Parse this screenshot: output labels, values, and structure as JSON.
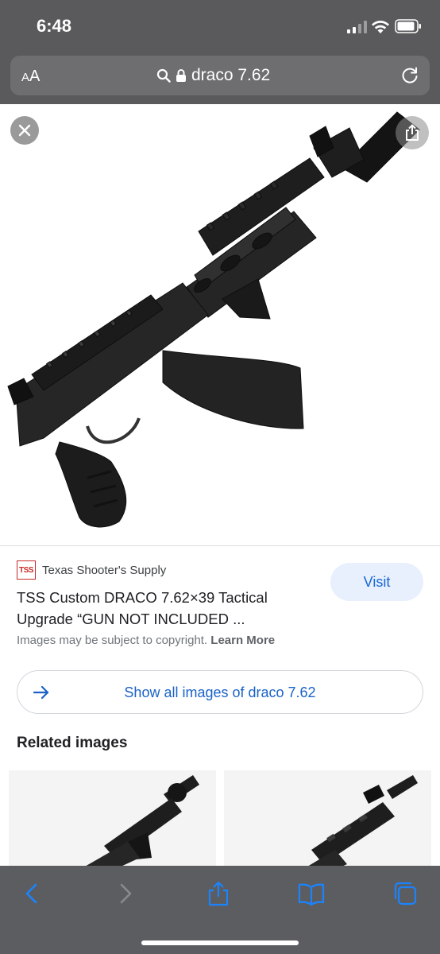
{
  "status_bar": {
    "time": "6:48"
  },
  "address_bar": {
    "text_size_label_small": "A",
    "text_size_label_large": "A",
    "url": "draco 7.62"
  },
  "result": {
    "source_badge": "TSS",
    "source_name": "Texas Shooter's Supply",
    "title": "TSS Custom DRACO 7.62×39 Tactical Upgrade “GUN NOT INCLUDED ...",
    "visit_label": "Visit",
    "copyright_text": "Images may be subject to copyright.",
    "learn_more_label": "Learn More",
    "show_all_label": "Show all images of draco 7.62"
  },
  "related": {
    "heading": "Related images"
  },
  "icons": {
    "close": "close-icon",
    "share": "share-icon",
    "search": "search-icon",
    "lock": "lock-icon",
    "reload": "reload-icon",
    "back": "back-icon",
    "forward": "forward-icon",
    "bookmarks": "bookmarks-icon",
    "tabs": "tabs-icon"
  },
  "colors": {
    "chrome": "#5a5a5c",
    "link_blue": "#1a62c7",
    "visit_bg": "#e8f0fe",
    "tss_red": "#c62828"
  }
}
